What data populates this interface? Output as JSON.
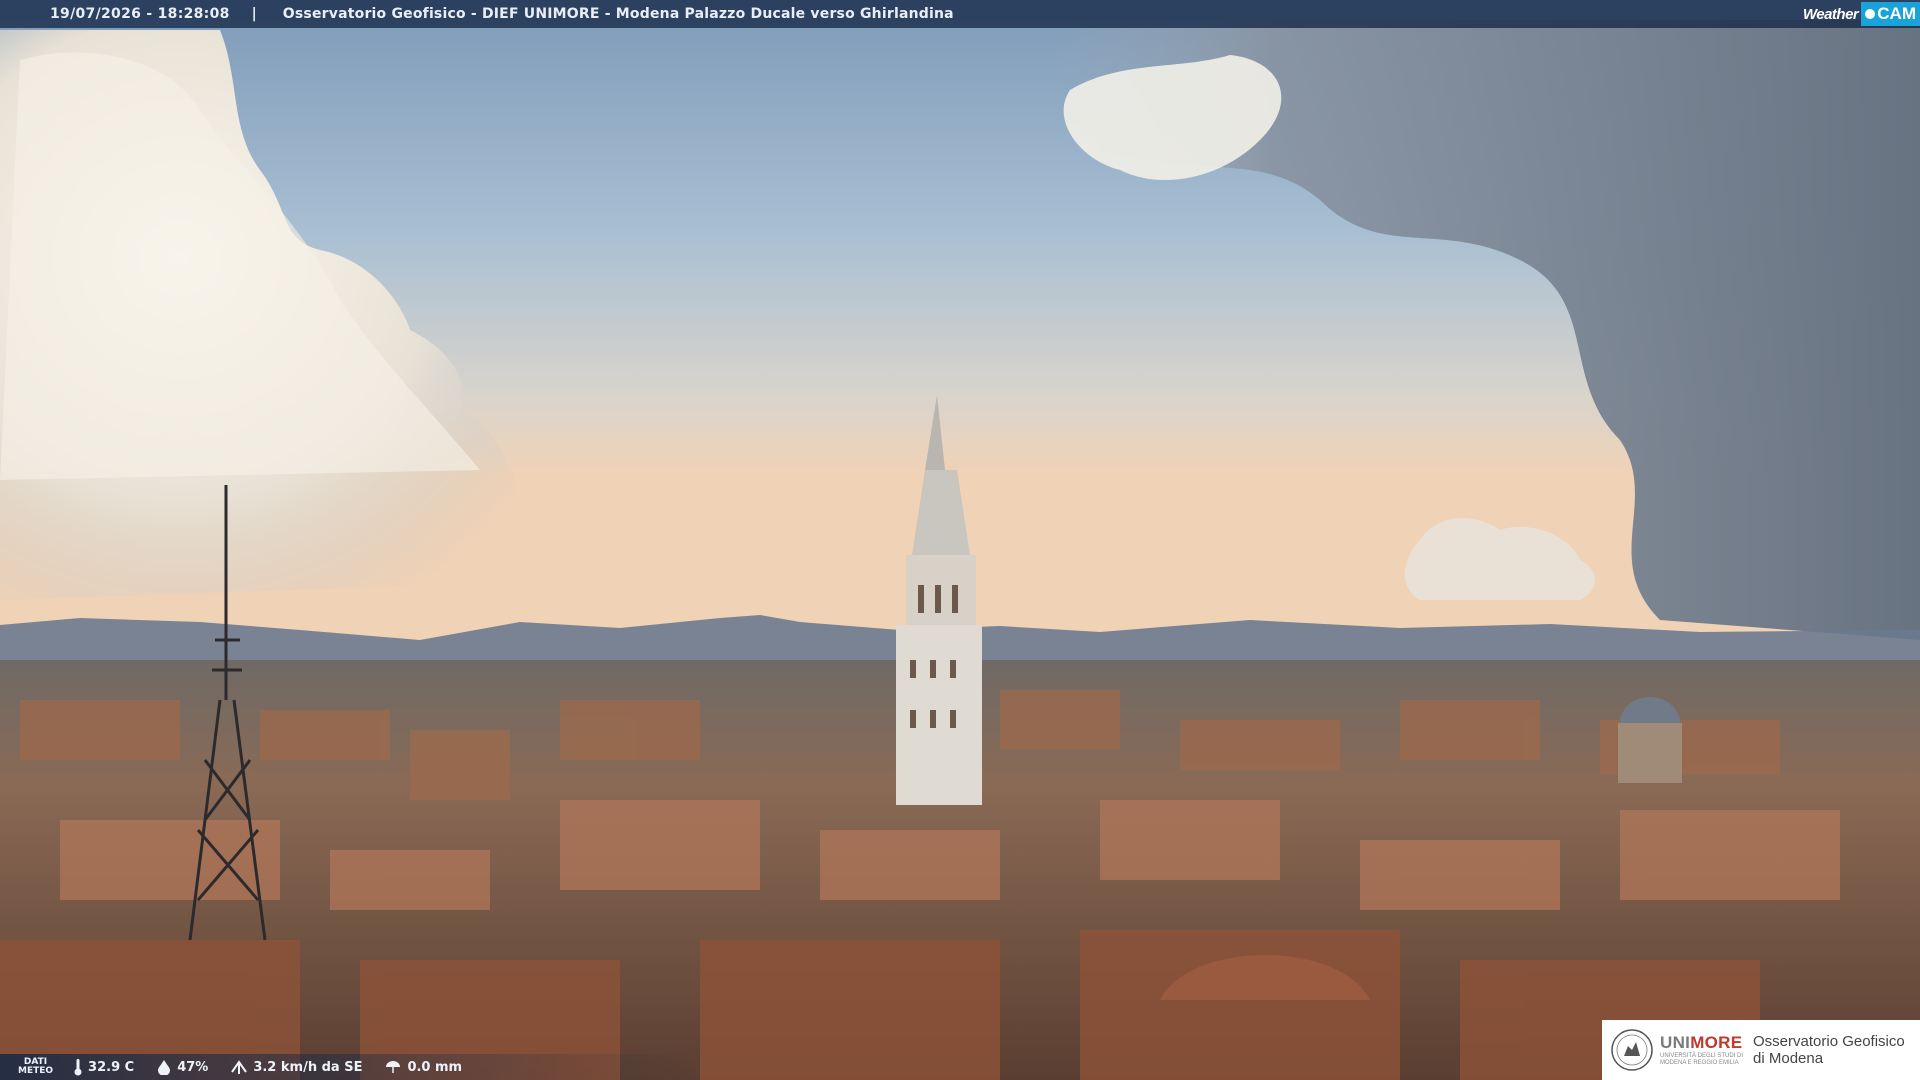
{
  "header": {
    "timestamp": "19/07/2026 - 18:28:08",
    "separator": "|",
    "title": "Osservatorio Geofisico - DIEF UNIMORE - Modena Palazzo Ducale verso Ghirlandina",
    "logo_text_weather": "Weather",
    "logo_text_cam": "CAM"
  },
  "weather": {
    "label_line1": "DATI",
    "label_line2": "METEO",
    "temperature": "32.9 C",
    "humidity": "47%",
    "wind": "3.2 km/h da SE",
    "rain": "0.0 mm"
  },
  "footer_logo": {
    "brand_uni": "UNI",
    "brand_more": "MORE",
    "university_line1": "UNIVERSITÀ DEGLI STUDI DI",
    "university_line2": "MODENA E REGGIO EMILIA",
    "observatory_line1": "Osservatorio Geofisico",
    "observatory_line2": "di Modena"
  },
  "icons": [
    "thermometer-icon",
    "humidity-drop-icon",
    "wind-icon",
    "rain-icon",
    "camera-dot-icon",
    "unimore-seal-icon"
  ],
  "colors": {
    "header_bg": "#142846",
    "accent_cam": "#1aa3d9",
    "unimore_red": "#c0392b"
  }
}
